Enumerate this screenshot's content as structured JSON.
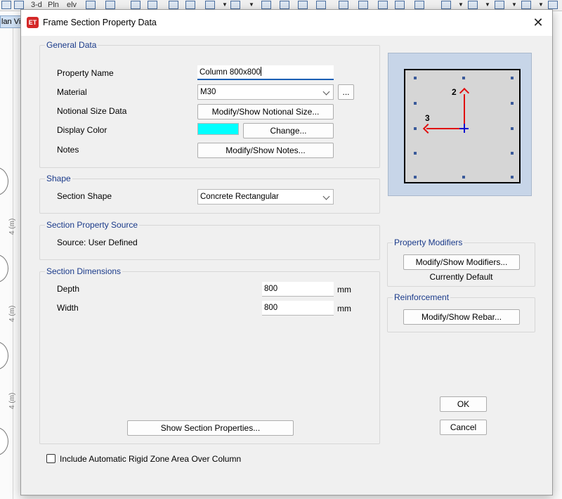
{
  "toolbar": {
    "view_3d": "3-d",
    "plan": "Pln",
    "elev": "elv"
  },
  "background": {
    "plan_tab": "lan Vi",
    "dimensions": [
      "4 (m)",
      "4 (m)",
      "4 (m)"
    ]
  },
  "dialog": {
    "title": "Frame Section Property Data",
    "logo": "ET",
    "general": {
      "heading": "General Data",
      "property_name_label": "Property Name",
      "property_name_value": "Column 800x800",
      "material_label": "Material",
      "material_value": "M30",
      "material_more": "...",
      "notional_label": "Notional Size Data",
      "notional_button": "Modify/Show Notional Size...",
      "display_color_label": "Display Color",
      "display_color_value": "#00ffff",
      "change_button": "Change...",
      "notes_label": "Notes",
      "notes_button": "Modify/Show Notes..."
    },
    "shape": {
      "heading": "Shape",
      "section_shape_label": "Section Shape",
      "section_shape_value": "Concrete Rectangular"
    },
    "source": {
      "heading": "Section Property Source",
      "source_text": "Source:  User Defined"
    },
    "dimensions": {
      "heading": "Section Dimensions",
      "depth_label": "Depth",
      "depth_value": "800",
      "depth_unit": "mm",
      "width_label": "Width",
      "width_value": "800",
      "width_unit": "mm",
      "show_props_button": "Show Section Properties..."
    },
    "preview": {
      "axis2": "2",
      "axis3": "3"
    },
    "modifiers": {
      "heading": "Property Modifiers",
      "button": "Modify/Show Modifiers...",
      "status": "Currently Default"
    },
    "reinforcement": {
      "heading": "Reinforcement",
      "button": "Modify/Show Rebar..."
    },
    "ok_button": "OK",
    "cancel_button": "Cancel",
    "rigid_zone_label": "Include Automatic Rigid Zone Area Over Column",
    "rigid_zone_checked": false
  }
}
